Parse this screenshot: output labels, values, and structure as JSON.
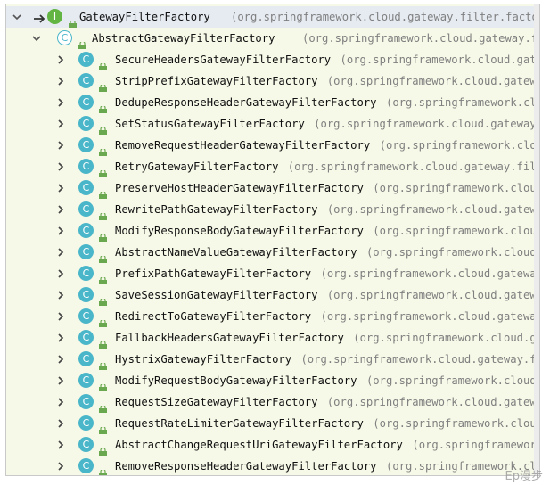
{
  "root": {
    "name": "GatewayFilterFactory",
    "package": "(org.springframework.cloud.gateway.filter.factory)"
  },
  "abstract_node": {
    "name": "AbstractGatewayFilterFactory",
    "package": "(org.springframework.cloud.gateway.filter.factory)"
  },
  "children": [
    {
      "name": "SecureHeadersGatewayFilterFactory",
      "package": "(org.springframework.cloud.gateway.filter.factory)"
    },
    {
      "name": "StripPrefixGatewayFilterFactory",
      "package": "(org.springframework.cloud.gateway.filter.factory)"
    },
    {
      "name": "DedupeResponseHeaderGatewayFilterFactory",
      "package": "(org.springframework.cloud.gateway.filter.factory)"
    },
    {
      "name": "SetStatusGatewayFilterFactory",
      "package": "(org.springframework.cloud.gateway.filter.factory)"
    },
    {
      "name": "RemoveRequestHeaderGatewayFilterFactory",
      "package": "(org.springframework.cloud.gateway.filter.factory)"
    },
    {
      "name": "RetryGatewayFilterFactory",
      "package": "(org.springframework.cloud.gateway.filter.factory)"
    },
    {
      "name": "PreserveHostHeaderGatewayFilterFactory",
      "package": "(org.springframework.cloud.gateway.filter.factory)"
    },
    {
      "name": "RewritePathGatewayFilterFactory",
      "package": "(org.springframework.cloud.gateway.filter.factory)"
    },
    {
      "name": "ModifyResponseBodyGatewayFilterFactory",
      "package": "(org.springframework.cloud.gateway.filter.factory)"
    },
    {
      "name": "AbstractNameValueGatewayFilterFactory",
      "package": "(org.springframework.cloud.gateway.filter.factory)"
    },
    {
      "name": "PrefixPathGatewayFilterFactory",
      "package": "(org.springframework.cloud.gateway.filter.factory)"
    },
    {
      "name": "SaveSessionGatewayFilterFactory",
      "package": "(org.springframework.cloud.gateway.filter.factory)"
    },
    {
      "name": "RedirectToGatewayFilterFactory",
      "package": "(org.springframework.cloud.gateway.filter.factory)"
    },
    {
      "name": "FallbackHeadersGatewayFilterFactory",
      "package": "(org.springframework.cloud.gateway.filter.factory)"
    },
    {
      "name": "HystrixGatewayFilterFactory",
      "package": "(org.springframework.cloud.gateway.filter.factory)"
    },
    {
      "name": "ModifyRequestBodyGatewayFilterFactory",
      "package": "(org.springframework.cloud.gateway.filter.factory)"
    },
    {
      "name": "RequestSizeGatewayFilterFactory",
      "package": "(org.springframework.cloud.gateway.filter.factory)"
    },
    {
      "name": "RequestRateLimiterGatewayFilterFactory",
      "package": "(org.springframework.cloud.gateway.filter.factory)"
    },
    {
      "name": "AbstractChangeRequestUriGatewayFilterFactory",
      "package": "(org.springframework.cloud.gateway.filter.factory)"
    },
    {
      "name": "RemoveResponseHeaderGatewayFilterFactory",
      "package": "(org.springframework.cloud.gateway.filter.factory)"
    }
  ],
  "icons": {
    "class_icon_letter": "C",
    "interface_icon_letter": "I",
    "class_color": "#4ab6c9",
    "interface_color": "#62b543",
    "lock_color": "#6aa84f"
  },
  "watermark": "Ep漫步"
}
